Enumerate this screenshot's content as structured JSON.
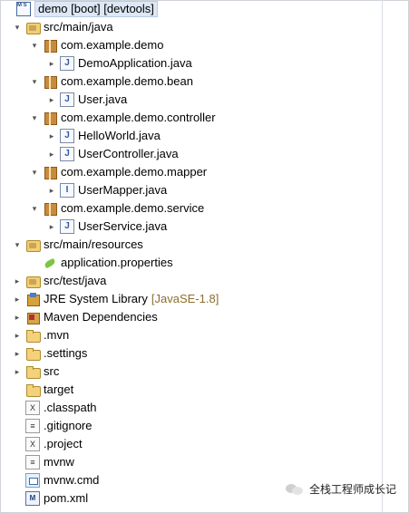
{
  "project": {
    "label": "demo [boot] [devtools]",
    "icon": "project-icon"
  },
  "tree": [
    {
      "name": "tree-item-src-main-java",
      "label": "src/main/java",
      "icon": "source-folder-icon",
      "expander": "▾",
      "level": 1
    },
    {
      "name": "tree-item-package",
      "label": "com.example.demo",
      "icon": "package-icon",
      "expander": "▾",
      "level": 2
    },
    {
      "name": "tree-item-file",
      "label": "DemoApplication.java",
      "icon": "java-file-icon",
      "expander": "▸",
      "level": 3
    },
    {
      "name": "tree-item-package",
      "label": "com.example.demo.bean",
      "icon": "package-icon",
      "expander": "▾",
      "level": 2
    },
    {
      "name": "tree-item-file",
      "label": "User.java",
      "icon": "java-file-icon",
      "expander": "▸",
      "level": 3
    },
    {
      "name": "tree-item-package",
      "label": "com.example.demo.controller",
      "icon": "package-icon",
      "expander": "▾",
      "level": 2
    },
    {
      "name": "tree-item-file",
      "label": "HelloWorld.java",
      "icon": "java-file-icon",
      "expander": "▸",
      "level": 3
    },
    {
      "name": "tree-item-file",
      "label": "UserController.java",
      "icon": "java-file-icon",
      "expander": "▸",
      "level": 3
    },
    {
      "name": "tree-item-package",
      "label": "com.example.demo.mapper",
      "icon": "package-icon",
      "expander": "▾",
      "level": 2
    },
    {
      "name": "tree-item-file",
      "label": "UserMapper.java",
      "icon": "java-interface-icon",
      "expander": "▸",
      "level": 3
    },
    {
      "name": "tree-item-package",
      "label": "com.example.demo.service",
      "icon": "package-icon",
      "expander": "▾",
      "level": 2
    },
    {
      "name": "tree-item-file",
      "label": "UserService.java",
      "icon": "java-file-icon",
      "expander": "▸",
      "level": 3
    },
    {
      "name": "tree-item-src-main-resources",
      "label": "src/main/resources",
      "icon": "source-folder-icon",
      "expander": "▾",
      "level": 1
    },
    {
      "name": "tree-item-file",
      "label": "application.properties",
      "icon": "properties-file-icon",
      "expander": "",
      "level": 2
    },
    {
      "name": "tree-item-src-test-java",
      "label": "src/test/java",
      "icon": "source-folder-icon",
      "expander": "▸",
      "level": 1
    },
    {
      "name": "tree-item-jre-library",
      "label": "JRE System Library",
      "decor": "[JavaSE-1.8]",
      "icon": "library-icon",
      "expander": "▸",
      "level": 1
    },
    {
      "name": "tree-item-maven-dependencies",
      "label": "Maven Dependencies",
      "icon": "maven-library-icon",
      "expander": "▸",
      "level": 1
    },
    {
      "name": "tree-item-folder",
      "label": ".mvn",
      "icon": "folder-icon",
      "expander": "▸",
      "level": 1
    },
    {
      "name": "tree-item-folder",
      "label": ".settings",
      "icon": "folder-icon",
      "expander": "▸",
      "level": 1
    },
    {
      "name": "tree-item-folder",
      "label": "src",
      "icon": "folder-icon",
      "expander": "▸",
      "level": 1
    },
    {
      "name": "tree-item-folder",
      "label": "target",
      "icon": "folder-icon",
      "expander": "",
      "level": 1
    },
    {
      "name": "tree-item-file",
      "label": ".classpath",
      "icon": "xml-file-icon",
      "expander": "",
      "level": 1
    },
    {
      "name": "tree-item-file",
      "label": ".gitignore",
      "icon": "text-file-icon",
      "expander": "",
      "level": 1
    },
    {
      "name": "tree-item-file",
      "label": ".project",
      "icon": "xml-file-icon",
      "expander": "",
      "level": 1
    },
    {
      "name": "tree-item-file",
      "label": "mvnw",
      "icon": "text-file-icon",
      "expander": "",
      "level": 1
    },
    {
      "name": "tree-item-file",
      "label": "mvnw.cmd",
      "icon": "cmd-file-icon",
      "expander": "",
      "level": 1
    },
    {
      "name": "tree-item-file",
      "label": "pom.xml",
      "icon": "pom-file-icon",
      "expander": "",
      "level": 1
    }
  ],
  "watermark": {
    "text": "全栈工程师成长记",
    "icon": "wechat-icon"
  }
}
